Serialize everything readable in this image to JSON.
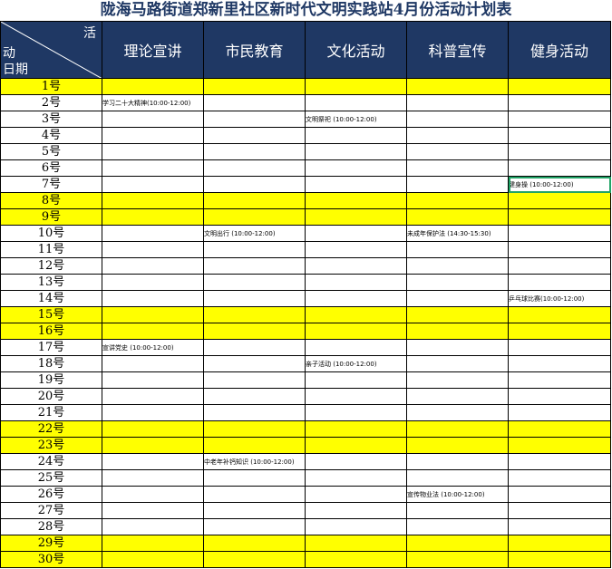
{
  "title": "陇海马路街道郑新里社区新时代文明实践站4月份活动计划表",
  "header": {
    "corner_top": "活",
    "corner_mid": "动",
    "corner_bottom": "日期",
    "categories": [
      "理论宣讲",
      "市民教育",
      "文化活动",
      "科普宣传",
      "健身活动"
    ]
  },
  "colors": {
    "header_bg": "#1f3864",
    "highlight": "#ffff00",
    "selection": "#21a366"
  },
  "rows": [
    {
      "day": "1号",
      "c1": "",
      "c2": "",
      "c3": "",
      "c4": "",
      "c5": ""
    },
    {
      "day": "2号",
      "c1": "学习二十大精神(10:00-12:00)",
      "c2": "",
      "c3": "",
      "c4": "",
      "c5": ""
    },
    {
      "day": "3号",
      "c1": "",
      "c2": "",
      "c3": "文明祭祀 (10:00-12:00)",
      "c4": "",
      "c5": ""
    },
    {
      "day": "4号",
      "c1": "",
      "c2": "",
      "c3": "",
      "c4": "",
      "c5": ""
    },
    {
      "day": "5号",
      "c1": "",
      "c2": "",
      "c3": "",
      "c4": "",
      "c5": ""
    },
    {
      "day": "6号",
      "c1": "",
      "c2": "",
      "c3": "",
      "c4": "",
      "c5": ""
    },
    {
      "day": "7号",
      "c1": "",
      "c2": "",
      "c3": "",
      "c4": "",
      "c5": "健身操 (10:00-12:00)"
    },
    {
      "day": "8号",
      "c1": "",
      "c2": "",
      "c3": "",
      "c4": "",
      "c5": ""
    },
    {
      "day": "9号",
      "c1": "",
      "c2": "",
      "c3": "",
      "c4": "",
      "c5": ""
    },
    {
      "day": "10号",
      "c1": "",
      "c2": "文明出行 (10:00-12:00)",
      "c3": "",
      "c4": "未成年保护法 (14:30-15:30)",
      "c5": ""
    },
    {
      "day": "11号",
      "c1": "",
      "c2": "",
      "c3": "",
      "c4": "",
      "c5": ""
    },
    {
      "day": "12号",
      "c1": "",
      "c2": "",
      "c3": "",
      "c4": "",
      "c5": ""
    },
    {
      "day": "13号",
      "c1": "",
      "c2": "",
      "c3": "",
      "c4": "",
      "c5": ""
    },
    {
      "day": "14号",
      "c1": "",
      "c2": "",
      "c3": "",
      "c4": "",
      "c5": "乒乓球比赛(10:00-12:00)"
    },
    {
      "day": "15号",
      "c1": "",
      "c2": "",
      "c3": "",
      "c4": "",
      "c5": ""
    },
    {
      "day": "16号",
      "c1": "",
      "c2": "",
      "c3": "",
      "c4": "",
      "c5": ""
    },
    {
      "day": "17号",
      "c1": "宣讲党史 (10:00-12:00)",
      "c2": "",
      "c3": "",
      "c4": "",
      "c5": ""
    },
    {
      "day": "18号",
      "c1": "",
      "c2": "",
      "c3": "亲子活动 (10:00-12:00)",
      "c4": "",
      "c5": ""
    },
    {
      "day": "19号",
      "c1": "",
      "c2": "",
      "c3": "",
      "c4": "",
      "c5": ""
    },
    {
      "day": "20号",
      "c1": "",
      "c2": "",
      "c3": "",
      "c4": "",
      "c5": ""
    },
    {
      "day": "21号",
      "c1": "",
      "c2": "",
      "c3": "",
      "c4": "",
      "c5": ""
    },
    {
      "day": "22号",
      "c1": "",
      "c2": "",
      "c3": "",
      "c4": "",
      "c5": ""
    },
    {
      "day": "23号",
      "c1": "",
      "c2": "",
      "c3": "",
      "c4": "",
      "c5": ""
    },
    {
      "day": "24号",
      "c1": "",
      "c2": "中老年补钙知识 (10:00-12:00)",
      "c3": "",
      "c4": "",
      "c5": ""
    },
    {
      "day": "25号",
      "c1": "",
      "c2": "",
      "c3": "",
      "c4": "",
      "c5": ""
    },
    {
      "day": "26号",
      "c1": "",
      "c2": "",
      "c3": "",
      "c4": "宣传物业法 (10:00-12:00)",
      "c5": ""
    },
    {
      "day": "27号",
      "c1": "",
      "c2": "",
      "c3": "",
      "c4": "",
      "c5": ""
    },
    {
      "day": "28号",
      "c1": "",
      "c2": "",
      "c3": "",
      "c4": "",
      "c5": ""
    },
    {
      "day": "29号",
      "c1": "",
      "c2": "",
      "c3": "",
      "c4": "",
      "c5": ""
    },
    {
      "day": "30号",
      "c1": "",
      "c2": "",
      "c3": "",
      "c4": "",
      "c5": ""
    }
  ]
}
